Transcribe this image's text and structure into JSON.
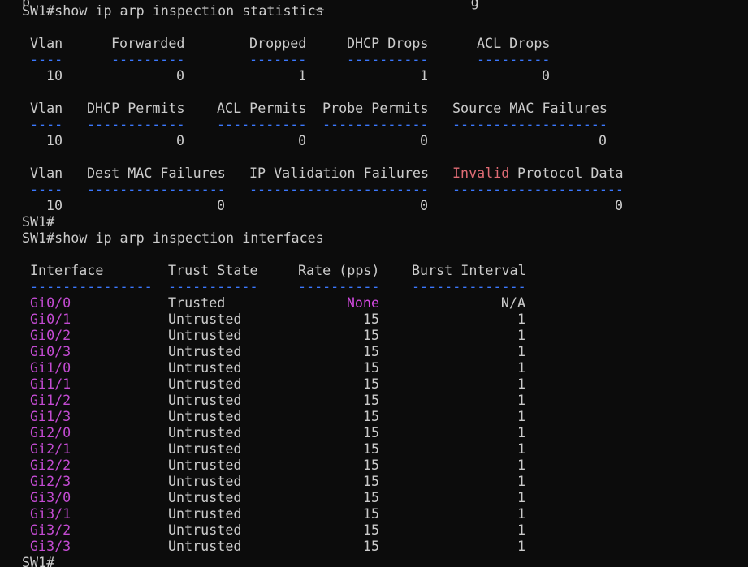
{
  "top_partial": "p                                   _                  g",
  "prompt_stats": "SW1#show ip arp inspection statistics",
  "stats_block1": {
    "headers": [
      "Vlan",
      "Forwarded",
      "Dropped",
      "DHCP Drops",
      "ACL Drops"
    ],
    "dashes": [
      "----",
      "---------",
      "-------",
      "----------",
      "---------"
    ],
    "values": [
      "10",
      "0",
      "1",
      "1",
      "0"
    ]
  },
  "stats_block2": {
    "headers": [
      "Vlan",
      "DHCP Permits",
      "ACL Permits",
      "Probe Permits",
      "Source MAC Failures"
    ],
    "dashes": [
      "----",
      "------------",
      "-----------",
      "-------------",
      "-------------------"
    ],
    "values": [
      "10",
      "0",
      "0",
      "0",
      "0"
    ]
  },
  "stats_block3": {
    "headers": [
      "Vlan",
      "Dest MAC Failures",
      "IP Validation Failures",
      "Invalid",
      "Protocol Data"
    ],
    "dashes": [
      "----",
      "-----------------",
      "----------------------",
      "---------------------"
    ],
    "values": [
      "10",
      "0",
      "0",
      "0"
    ]
  },
  "prompt_blank": "SW1#",
  "prompt_interfaces": "SW1#show ip arp inspection interfaces",
  "interfaces_table": {
    "headers": [
      "Interface",
      "Trust State",
      "Rate (pps)",
      "Burst Interval"
    ],
    "dashes": [
      "---------------",
      "-----------",
      "----------",
      "--------------"
    ],
    "rows": [
      {
        "iface": "Gi0/0",
        "trust": "Trusted",
        "rate": "None",
        "burst": "N/A"
      },
      {
        "iface": "Gi0/1",
        "trust": "Untrusted",
        "rate": "15",
        "burst": "1"
      },
      {
        "iface": "Gi0/2",
        "trust": "Untrusted",
        "rate": "15",
        "burst": "1"
      },
      {
        "iface": "Gi0/3",
        "trust": "Untrusted",
        "rate": "15",
        "burst": "1"
      },
      {
        "iface": "Gi1/0",
        "trust": "Untrusted",
        "rate": "15",
        "burst": "1"
      },
      {
        "iface": "Gi1/1",
        "trust": "Untrusted",
        "rate": "15",
        "burst": "1"
      },
      {
        "iface": "Gi1/2",
        "trust": "Untrusted",
        "rate": "15",
        "burst": "1"
      },
      {
        "iface": "Gi1/3",
        "trust": "Untrusted",
        "rate": "15",
        "burst": "1"
      },
      {
        "iface": "Gi2/0",
        "trust": "Untrusted",
        "rate": "15",
        "burst": "1"
      },
      {
        "iface": "Gi2/1",
        "trust": "Untrusted",
        "rate": "15",
        "burst": "1"
      },
      {
        "iface": "Gi2/2",
        "trust": "Untrusted",
        "rate": "15",
        "burst": "1"
      },
      {
        "iface": "Gi2/3",
        "trust": "Untrusted",
        "rate": "15",
        "burst": "1"
      },
      {
        "iface": "Gi3/0",
        "trust": "Untrusted",
        "rate": "15",
        "burst": "1"
      },
      {
        "iface": "Gi3/1",
        "trust": "Untrusted",
        "rate": "15",
        "burst": "1"
      },
      {
        "iface": "Gi3/2",
        "trust": "Untrusted",
        "rate": "15",
        "burst": "1"
      },
      {
        "iface": "Gi3/3",
        "trust": "Untrusted",
        "rate": "15",
        "burst": "1"
      }
    ]
  },
  "prompt_end": "SW1#",
  "colors": {
    "background": "#0c0c0c",
    "text": "#cccccc",
    "dash": "#3b78ff",
    "interface": "#c34bd2",
    "none_value": "#d54ae3",
    "invalid": "#e06c75"
  }
}
